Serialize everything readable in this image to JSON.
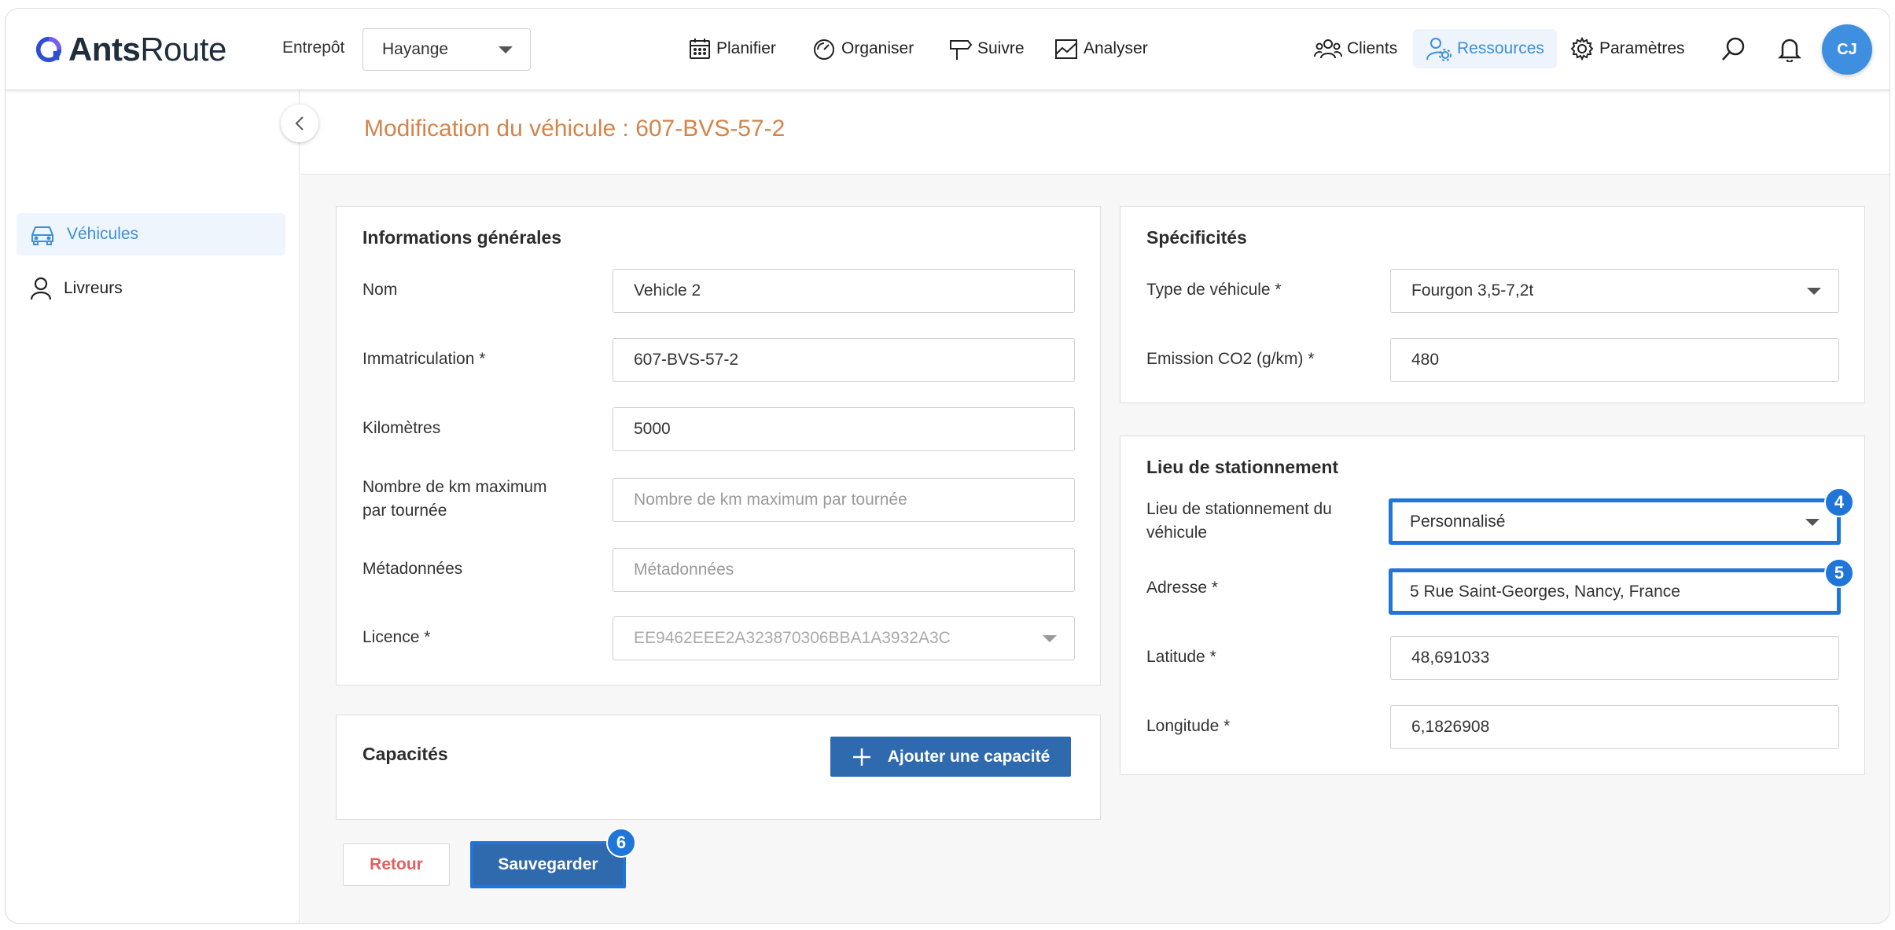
{
  "app": {
    "logo_text_bold": "Ants",
    "logo_text_light": "Route"
  },
  "header": {
    "warehouse_label": "Entrepôt",
    "warehouse_value": "Hayange",
    "nav": {
      "plan": "Planifier",
      "organize": "Organiser",
      "track": "Suivre",
      "analyze": "Analyser",
      "clients": "Clients",
      "resources": "Ressources",
      "settings": "Paramètres"
    },
    "avatar_initials": "CJ"
  },
  "sidebar": {
    "items": [
      {
        "label": "Véhicules",
        "active": true
      },
      {
        "label": "Livreurs",
        "active": false
      }
    ]
  },
  "page": {
    "title": "Modification du véhicule : 607-BVS-57-2"
  },
  "general": {
    "title": "Informations générales",
    "name_label": "Nom",
    "name_value": "Vehicle 2",
    "plate_label": "Immatriculation *",
    "plate_value": "607-BVS-57-2",
    "km_label": "Kilomètres",
    "km_value": "5000",
    "max_km_label_1": "Nombre de km maximum",
    "max_km_label_2": "par tournée",
    "max_km_placeholder": "Nombre de km maximum par tournée",
    "metadata_label": "Métadonnées",
    "metadata_placeholder": "Métadonnées",
    "license_label": "Licence *",
    "license_value": "EE9462EEE2A323870306BBA1A3932A3C"
  },
  "capacities": {
    "title": "Capacités",
    "add_button": "Ajouter une capacité"
  },
  "specs": {
    "title": "Spécificités",
    "type_label": "Type de véhicule *",
    "type_value": "Fourgon 3,5-7,2t",
    "co2_label": "Emission CO2 (g/km) *",
    "co2_value": "480"
  },
  "parking": {
    "title": "Lieu de stationnement",
    "place_label_1": "Lieu de stationnement du",
    "place_label_2": "véhicule",
    "place_value": "Personnalisé",
    "address_label": "Adresse *",
    "address_value": "5 Rue Saint-Georges, Nancy, France",
    "lat_label": "Latitude *",
    "lat_value": "48,691033",
    "lng_label": "Longitude *",
    "lng_value": "6,1826908"
  },
  "actions": {
    "back": "Retour",
    "save": "Sauvegarder"
  },
  "badges": {
    "place": "4",
    "address": "5",
    "save": "6"
  },
  "colors": {
    "accent": "#3d8fd6",
    "title": "#d4844a",
    "primary_button": "#2f6aaf",
    "highlight": "#1f76d8",
    "back_text": "#e06060"
  }
}
